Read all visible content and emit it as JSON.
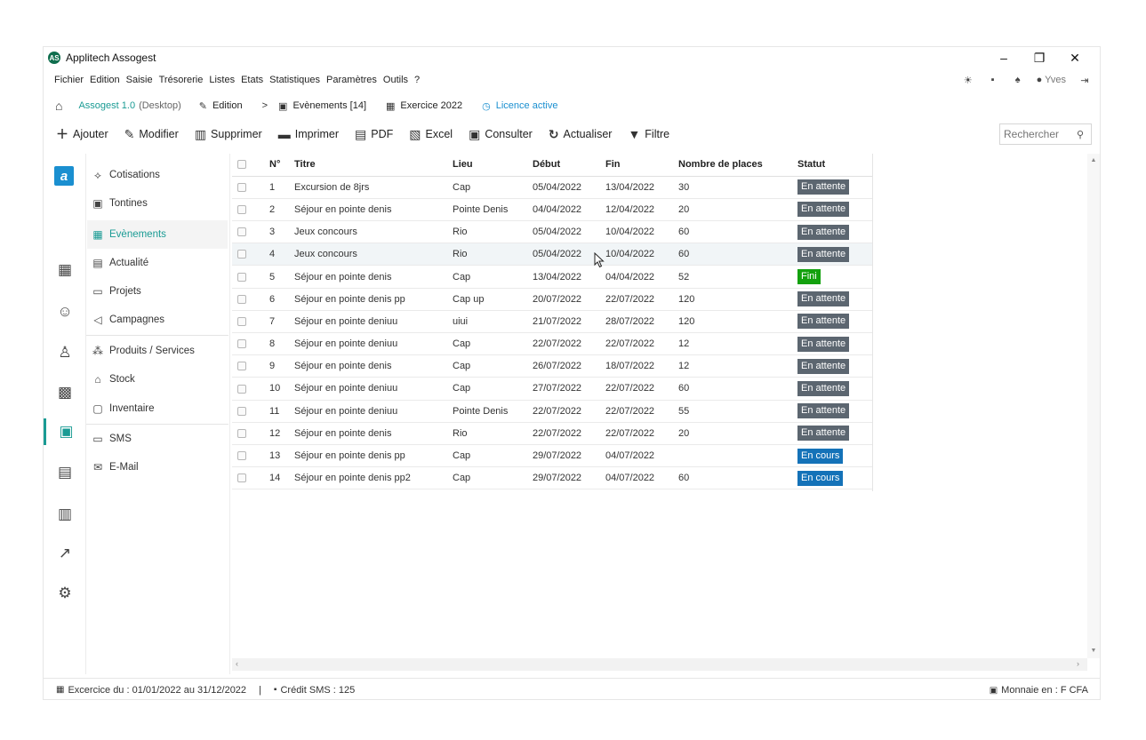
{
  "app": {
    "title": "Applitech Assogest",
    "logo_text": "AS"
  },
  "window_controls": {
    "minimize": "–",
    "restore": "❐",
    "close": "✕"
  },
  "menu": [
    "Fichier",
    "Edition",
    "Saisie",
    "Trésorerie",
    "Listes",
    "Etats",
    "Statistiques",
    "Paramètres",
    "Outils",
    "?"
  ],
  "menu_right": {
    "user": "Yves"
  },
  "breadcrumb": {
    "app": "Assogest 1.0",
    "env": "(Desktop)",
    "edition": "Edition",
    "separator": ">",
    "events": "Evènements [14]",
    "exercise": "Exercice 2022",
    "licence": "Licence active"
  },
  "toolbar": {
    "add": "Ajouter",
    "edit": "Modifier",
    "delete": "Supprimer",
    "print": "Imprimer",
    "pdf": "PDF",
    "excel": "Excel",
    "view": "Consulter",
    "refresh": "Actualiser",
    "filter": "Filtre",
    "search_placeholder": "Rechercher"
  },
  "rail_logo": "a",
  "subnav": [
    {
      "label": "Cotisations",
      "icon": "coin-icon",
      "glyph": "⟡"
    },
    {
      "label": "Tontines",
      "icon": "money-icon",
      "glyph": "▣"
    },
    {
      "label": "Evènements",
      "icon": "calendar-icon",
      "glyph": "▦",
      "active": true
    },
    {
      "label": "Actualité",
      "icon": "news-icon",
      "glyph": "▤"
    },
    {
      "label": "Projets",
      "icon": "folder-icon",
      "glyph": "▭"
    },
    {
      "label": "Campagnes",
      "icon": "megaphone-icon",
      "glyph": "◁"
    },
    {
      "label": "Produits / Services",
      "icon": "boxes-icon",
      "glyph": "⁂"
    },
    {
      "label": "Stock",
      "icon": "warehouse-icon",
      "glyph": "⌂"
    },
    {
      "label": "Inventaire",
      "icon": "clipboard-icon",
      "glyph": "▢"
    },
    {
      "label": "SMS",
      "icon": "chat-icon",
      "glyph": "▭"
    },
    {
      "label": "E-Mail",
      "icon": "mail-icon",
      "glyph": "✉"
    }
  ],
  "table": {
    "headers": {
      "num": "N°",
      "title": "Titre",
      "place": "Lieu",
      "start": "Début",
      "end": "Fin",
      "seats": "Nombre de places",
      "status": "Statut"
    },
    "rows": [
      {
        "num": "1",
        "title": "Excursion de 8jrs",
        "place": "Cap",
        "start": "05/04/2022",
        "end": "13/04/2022",
        "seats": "30",
        "status": "En attente",
        "kind": "wait"
      },
      {
        "num": "2",
        "title": "Séjour en pointe denis",
        "place": "Pointe Denis",
        "start": "04/04/2022",
        "end": "12/04/2022",
        "seats": "20",
        "status": "En attente",
        "kind": "wait"
      },
      {
        "num": "3",
        "title": "Jeux concours",
        "place": "Rio",
        "start": "05/04/2022",
        "end": "10/04/2022",
        "seats": "60",
        "status": "En attente",
        "kind": "wait"
      },
      {
        "num": "4",
        "title": "Jeux concours",
        "place": "Rio",
        "start": "05/04/2022",
        "end": "10/04/2022",
        "seats": "60",
        "status": "En attente",
        "kind": "wait"
      },
      {
        "num": "5",
        "title": "Séjour en pointe denis",
        "place": "Cap",
        "start": "13/04/2022",
        "end": "04/04/2022",
        "seats": "52",
        "status": "Fini",
        "kind": "fini"
      },
      {
        "num": "6",
        "title": "Séjour en pointe denis pp",
        "place": "Cap up",
        "start": "20/07/2022",
        "end": "22/07/2022",
        "seats": "120",
        "status": "En attente",
        "kind": "wait"
      },
      {
        "num": "7",
        "title": "Séjour en pointe deniuu",
        "place": "uiui",
        "start": "21/07/2022",
        "end": "28/07/2022",
        "seats": "120",
        "status": "En attente",
        "kind": "wait"
      },
      {
        "num": "8",
        "title": "Séjour en pointe deniuu",
        "place": "Cap",
        "start": "22/07/2022",
        "end": "22/07/2022",
        "seats": "12",
        "status": "En attente",
        "kind": "wait"
      },
      {
        "num": "9",
        "title": "Séjour en pointe denis",
        "place": "Cap",
        "start": "26/07/2022",
        "end": "18/07/2022",
        "seats": "12",
        "status": "En attente",
        "kind": "wait"
      },
      {
        "num": "10",
        "title": "Séjour en pointe deniuu",
        "place": "Cap",
        "start": "27/07/2022",
        "end": "22/07/2022",
        "seats": "60",
        "status": "En attente",
        "kind": "wait"
      },
      {
        "num": "11",
        "title": "Séjour en pointe deniuu",
        "place": "Pointe Denis",
        "start": "22/07/2022",
        "end": "22/07/2022",
        "seats": "55",
        "status": "En attente",
        "kind": "wait"
      },
      {
        "num": "12",
        "title": "Séjour en pointe denis",
        "place": "Rio",
        "start": "22/07/2022",
        "end": "22/07/2022",
        "seats": "20",
        "status": "En attente",
        "kind": "wait"
      },
      {
        "num": "13",
        "title": "Séjour en pointe denis pp",
        "place": "Cap",
        "start": "29/07/2022",
        "end": "04/07/2022",
        "seats": "",
        "status": "En cours",
        "kind": "cours"
      },
      {
        "num": "14",
        "title": "Séjour en pointe denis pp2",
        "place": "Cap",
        "start": "29/07/2022",
        "end": "04/07/2022",
        "seats": "60",
        "status": "En cours",
        "kind": "cours"
      }
    ]
  },
  "status_bar": {
    "exercise": "Excercice du : 01/01/2022 au 31/12/2022",
    "separator": "|",
    "sms": "Crédit SMS : 125",
    "currency": "Monnaie en : F CFA"
  },
  "colors": {
    "accent": "#1a9b94",
    "link": "#1a8fd0",
    "wait": "#5c6670",
    "fini": "#13a10e",
    "cours": "#1472b8"
  }
}
